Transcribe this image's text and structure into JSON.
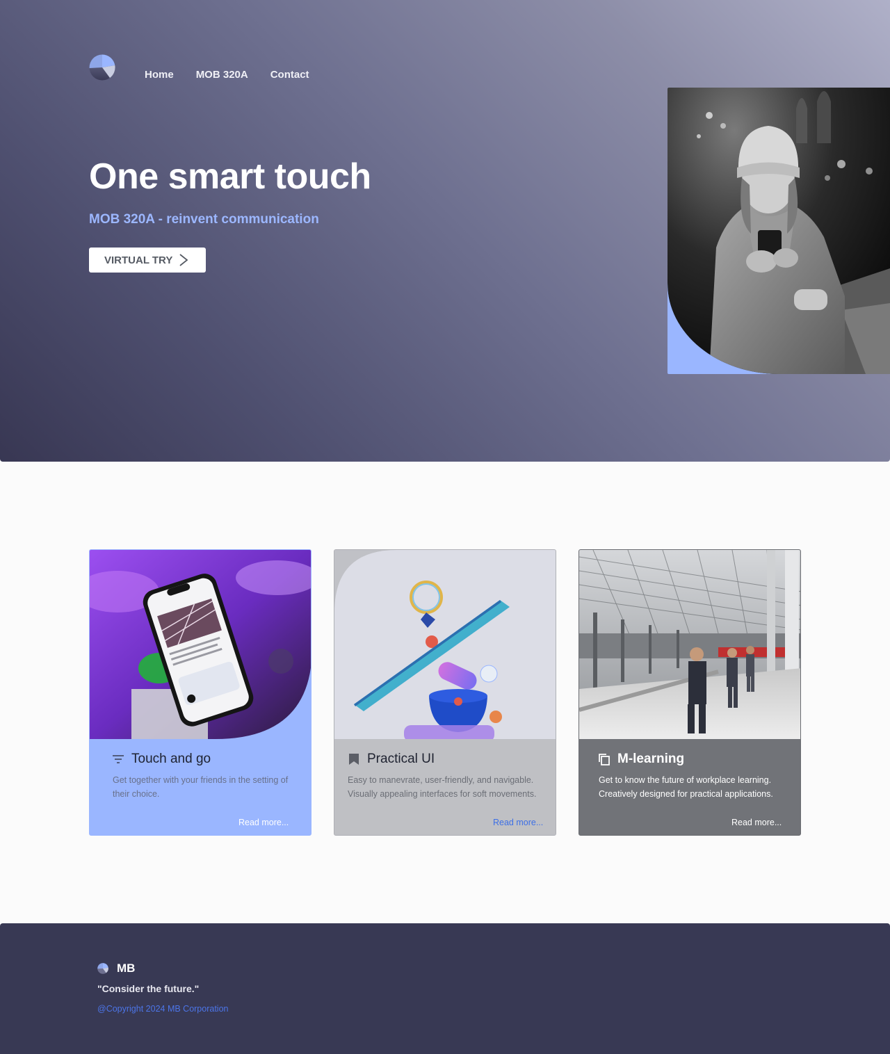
{
  "nav": {
    "items": [
      "Home",
      "MOB 320A",
      "Contact"
    ]
  },
  "hero": {
    "title": "One smart touch",
    "subtitle": "MOB 320A - reinvent communication",
    "cta_label": "VIRTUAL TRY"
  },
  "cards": [
    {
      "title": "Touch and go",
      "icon": "filter-lines-icon",
      "text": "Get together with your friends in the setting of their choice.",
      "link": "Read more..."
    },
    {
      "title": "Practical UI",
      "icon": "bookmark-icon",
      "text": "Easy to manevrate, user-friendly, and navigable. Visually appealing interfaces for soft movements.",
      "link": "Read more..."
    },
    {
      "title": "M-learning",
      "icon": "copy-icon",
      "text": "Get to know the future of workplace learning. Creatively designed for practical applications.",
      "link": "Read more..."
    }
  ],
  "footer": {
    "brand": "MB",
    "quote": "\"Consider the future.\"",
    "copyright": "@Copyright 2024 MB Corporation"
  },
  "colors": {
    "accent": "#9ab6ff",
    "footer_bg": "#383954",
    "link": "#3d6fe6"
  }
}
